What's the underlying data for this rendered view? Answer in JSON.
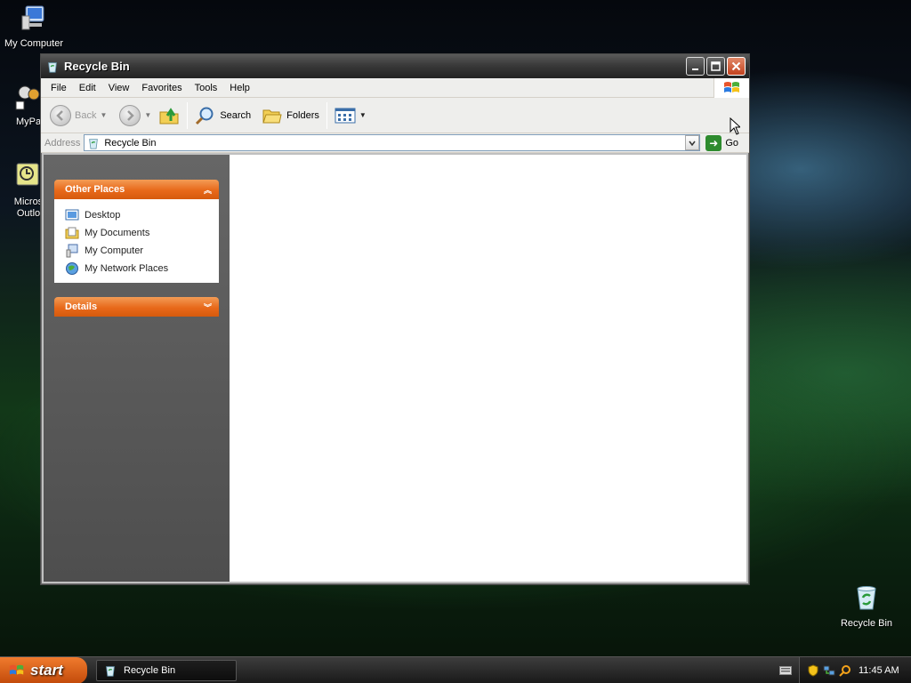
{
  "desktop": {
    "icons": [
      {
        "label": "My Computer"
      },
      {
        "label": "MyPa"
      },
      {
        "label": "Micros\nOutlo"
      },
      {
        "label": "Recycle Bin"
      }
    ]
  },
  "window": {
    "title": "Recycle Bin",
    "menu": [
      "File",
      "Edit",
      "View",
      "Favorites",
      "Tools",
      "Help"
    ],
    "toolbar": {
      "back_label": "Back",
      "search_label": "Search",
      "folders_label": "Folders"
    },
    "address": {
      "label": "Address",
      "value": "Recycle Bin",
      "go_label": "Go"
    },
    "taskpane": {
      "other_places": {
        "title": "Other Places",
        "items": [
          "Desktop",
          "My Documents",
          "My Computer",
          "My Network Places"
        ]
      },
      "details": {
        "title": "Details"
      }
    }
  },
  "taskbar": {
    "start_label": "start",
    "task_label": "Recycle Bin",
    "clock": "11:45 AM"
  },
  "colors": {
    "accent_orange": "#e8691a",
    "address_border": "#7f9db9"
  }
}
